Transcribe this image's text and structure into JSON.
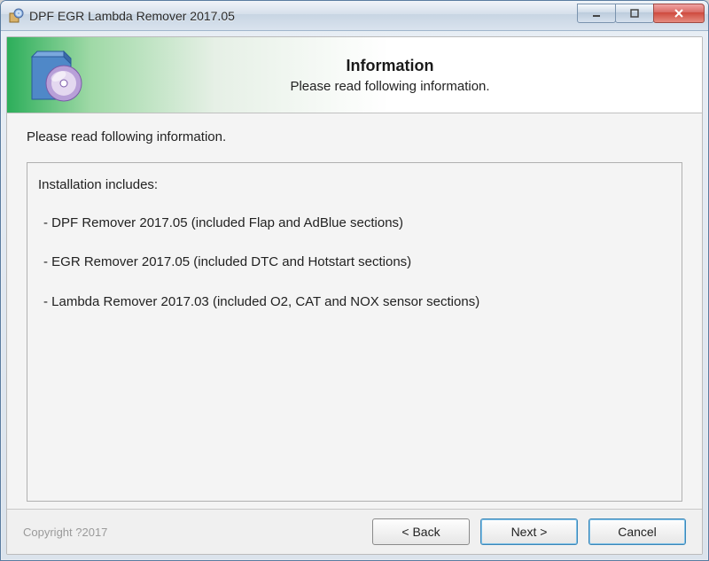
{
  "titlebar": {
    "title": "DPF EGR Lambda Remover 2017.05",
    "icons": {
      "app": "setup-icon",
      "minimize": "minimize-icon",
      "maximize": "maximize-icon",
      "close": "close-icon"
    }
  },
  "header": {
    "title": "Information",
    "subtitle": "Please read following information.",
    "icon": "box-cd-icon"
  },
  "body": {
    "lead": "Please read following information.",
    "info_heading": "Installation includes:",
    "items": [
      " - DPF Remover 2017.05 (included Flap and AdBlue sections)",
      " - EGR Remover 2017.05 (included DTC and Hotstart sections)",
      " - Lambda Remover 2017.03 (included O2, CAT and NOX sensor sections)"
    ]
  },
  "footer": {
    "copyright": "Copyright ?2017",
    "back": "< Back",
    "next": "Next >",
    "cancel": "Cancel"
  }
}
